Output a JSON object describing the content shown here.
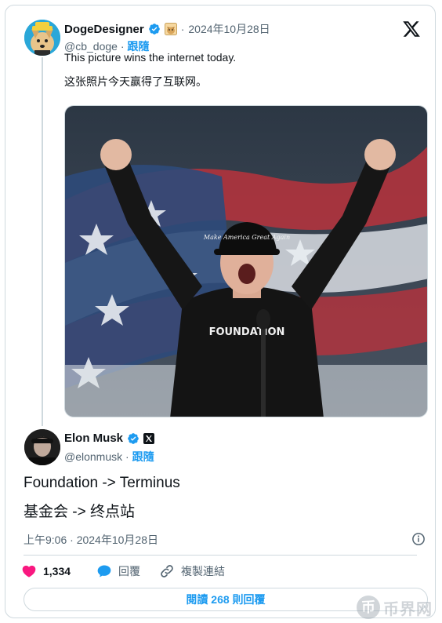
{
  "quoted": {
    "display_name": "DogeDesigner",
    "badge_icon": "doge-emoji-icon",
    "date": "2024年10月28日",
    "handle": "@cb_doge",
    "follow_label": "跟隨",
    "text_en": "This picture wins the internet today.",
    "text_zh": "这张照片今天赢得了互联网。",
    "photo_cap_text": "Make America Great Again",
    "photo_shirt_text": "FOUNDATION"
  },
  "tweet": {
    "display_name": "Elon Musk",
    "handle": "@elonmusk",
    "follow_label": "跟隨",
    "line1": "Foundation -> Terminus",
    "line2": "基金会 -> 终点站",
    "timestamp": "上午9:06 · 2024年10月28日"
  },
  "actions": {
    "likes": "1,334",
    "reply_label": "回覆",
    "copy_link_label": "複製連結"
  },
  "read_replies_label": "閱讀 268 則回覆",
  "watermark": {
    "symbol": "币",
    "text": "币界网"
  },
  "colors": {
    "accent": "#1d9bf0",
    "like": "#f91880",
    "muted": "#536471"
  }
}
